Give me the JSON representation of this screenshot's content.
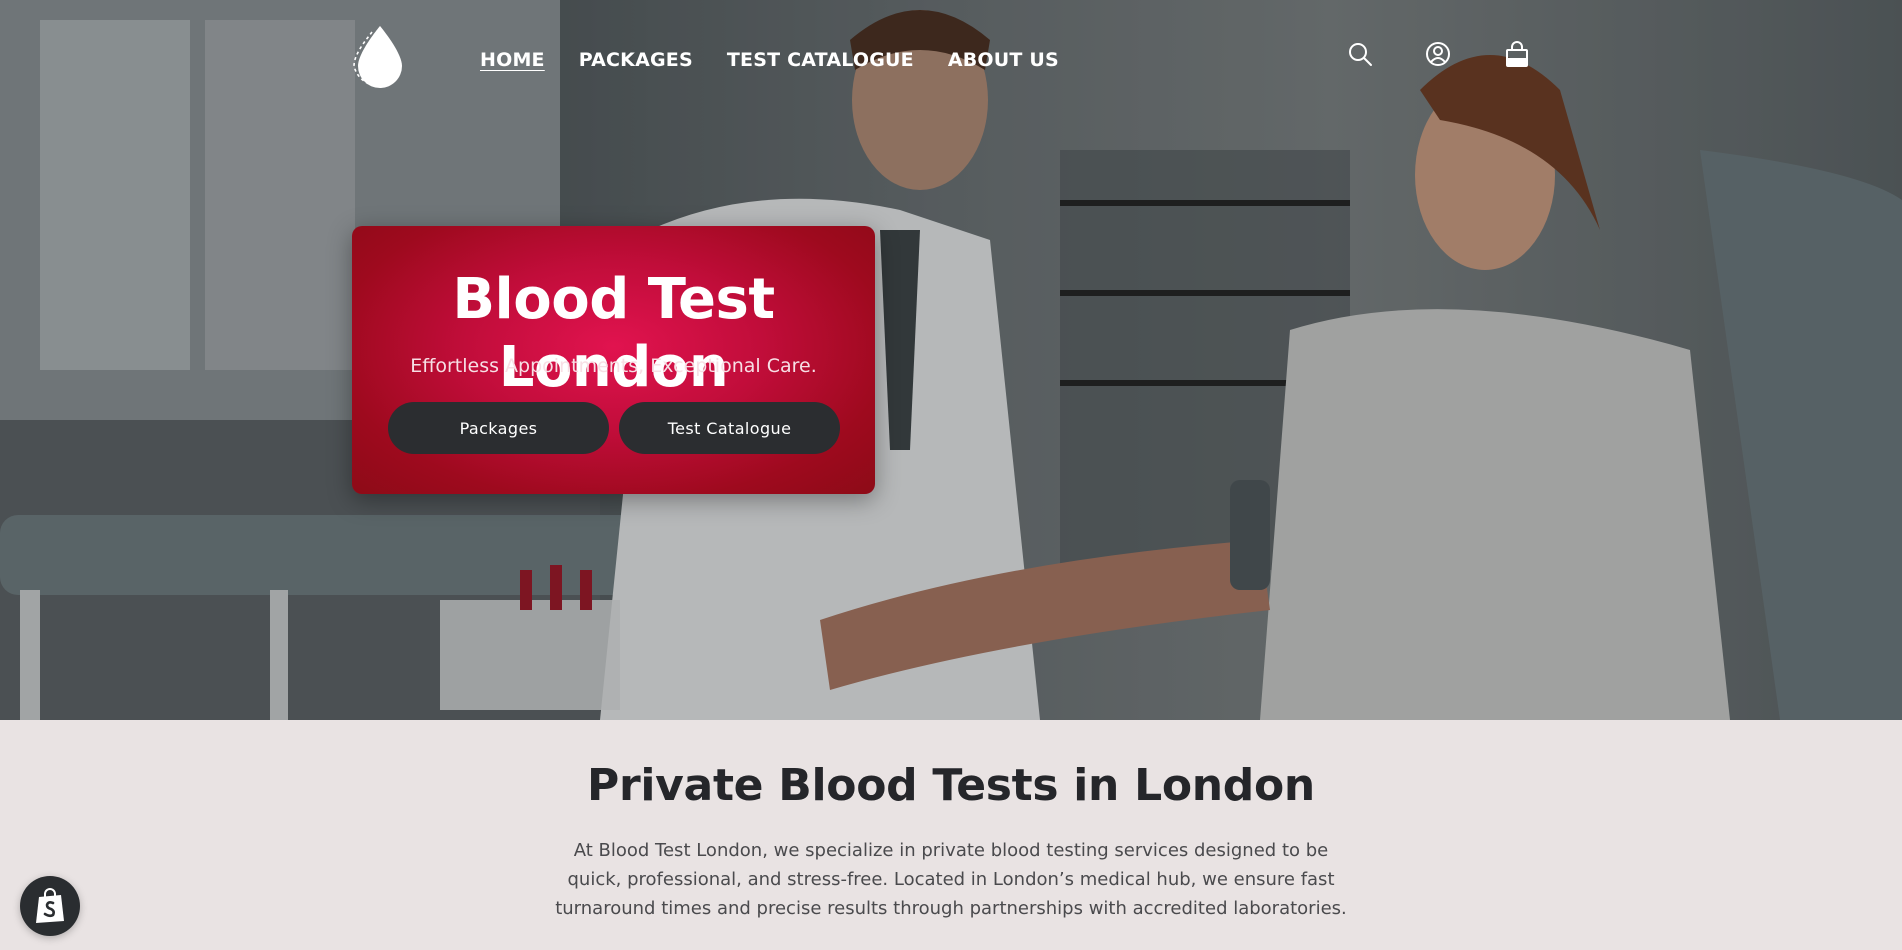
{
  "header": {
    "nav": [
      {
        "label": "HOME",
        "active": true
      },
      {
        "label": "PACKAGES",
        "active": false
      },
      {
        "label": "TEST CATALOGUE",
        "active": false
      },
      {
        "label": "ABOUT US",
        "active": false
      }
    ],
    "icons": [
      "search-icon",
      "account-icon",
      "cart-icon"
    ]
  },
  "hero": {
    "title": "Blood Test London",
    "subtitle": "Effortless Appointments, Exceptional Care.",
    "buttons": [
      {
        "label": "Packages"
      },
      {
        "label": "Test Catalogue"
      }
    ]
  },
  "intro": {
    "heading": "Private Blood Tests in London",
    "body": "At Blood Test London, we specialize in private blood testing services designed to be quick, professional, and stress-free. Located in London’s medical hub, we ensure fast turnaround times and precise results through partnerships with accredited laboratories."
  },
  "badge": {
    "icon": "shopify-bag-icon"
  },
  "colors": {
    "accent": "#c10d3a",
    "button_dark": "#2b2d30",
    "page_bg": "#e9e3e3",
    "text_dark": "#25262a"
  }
}
